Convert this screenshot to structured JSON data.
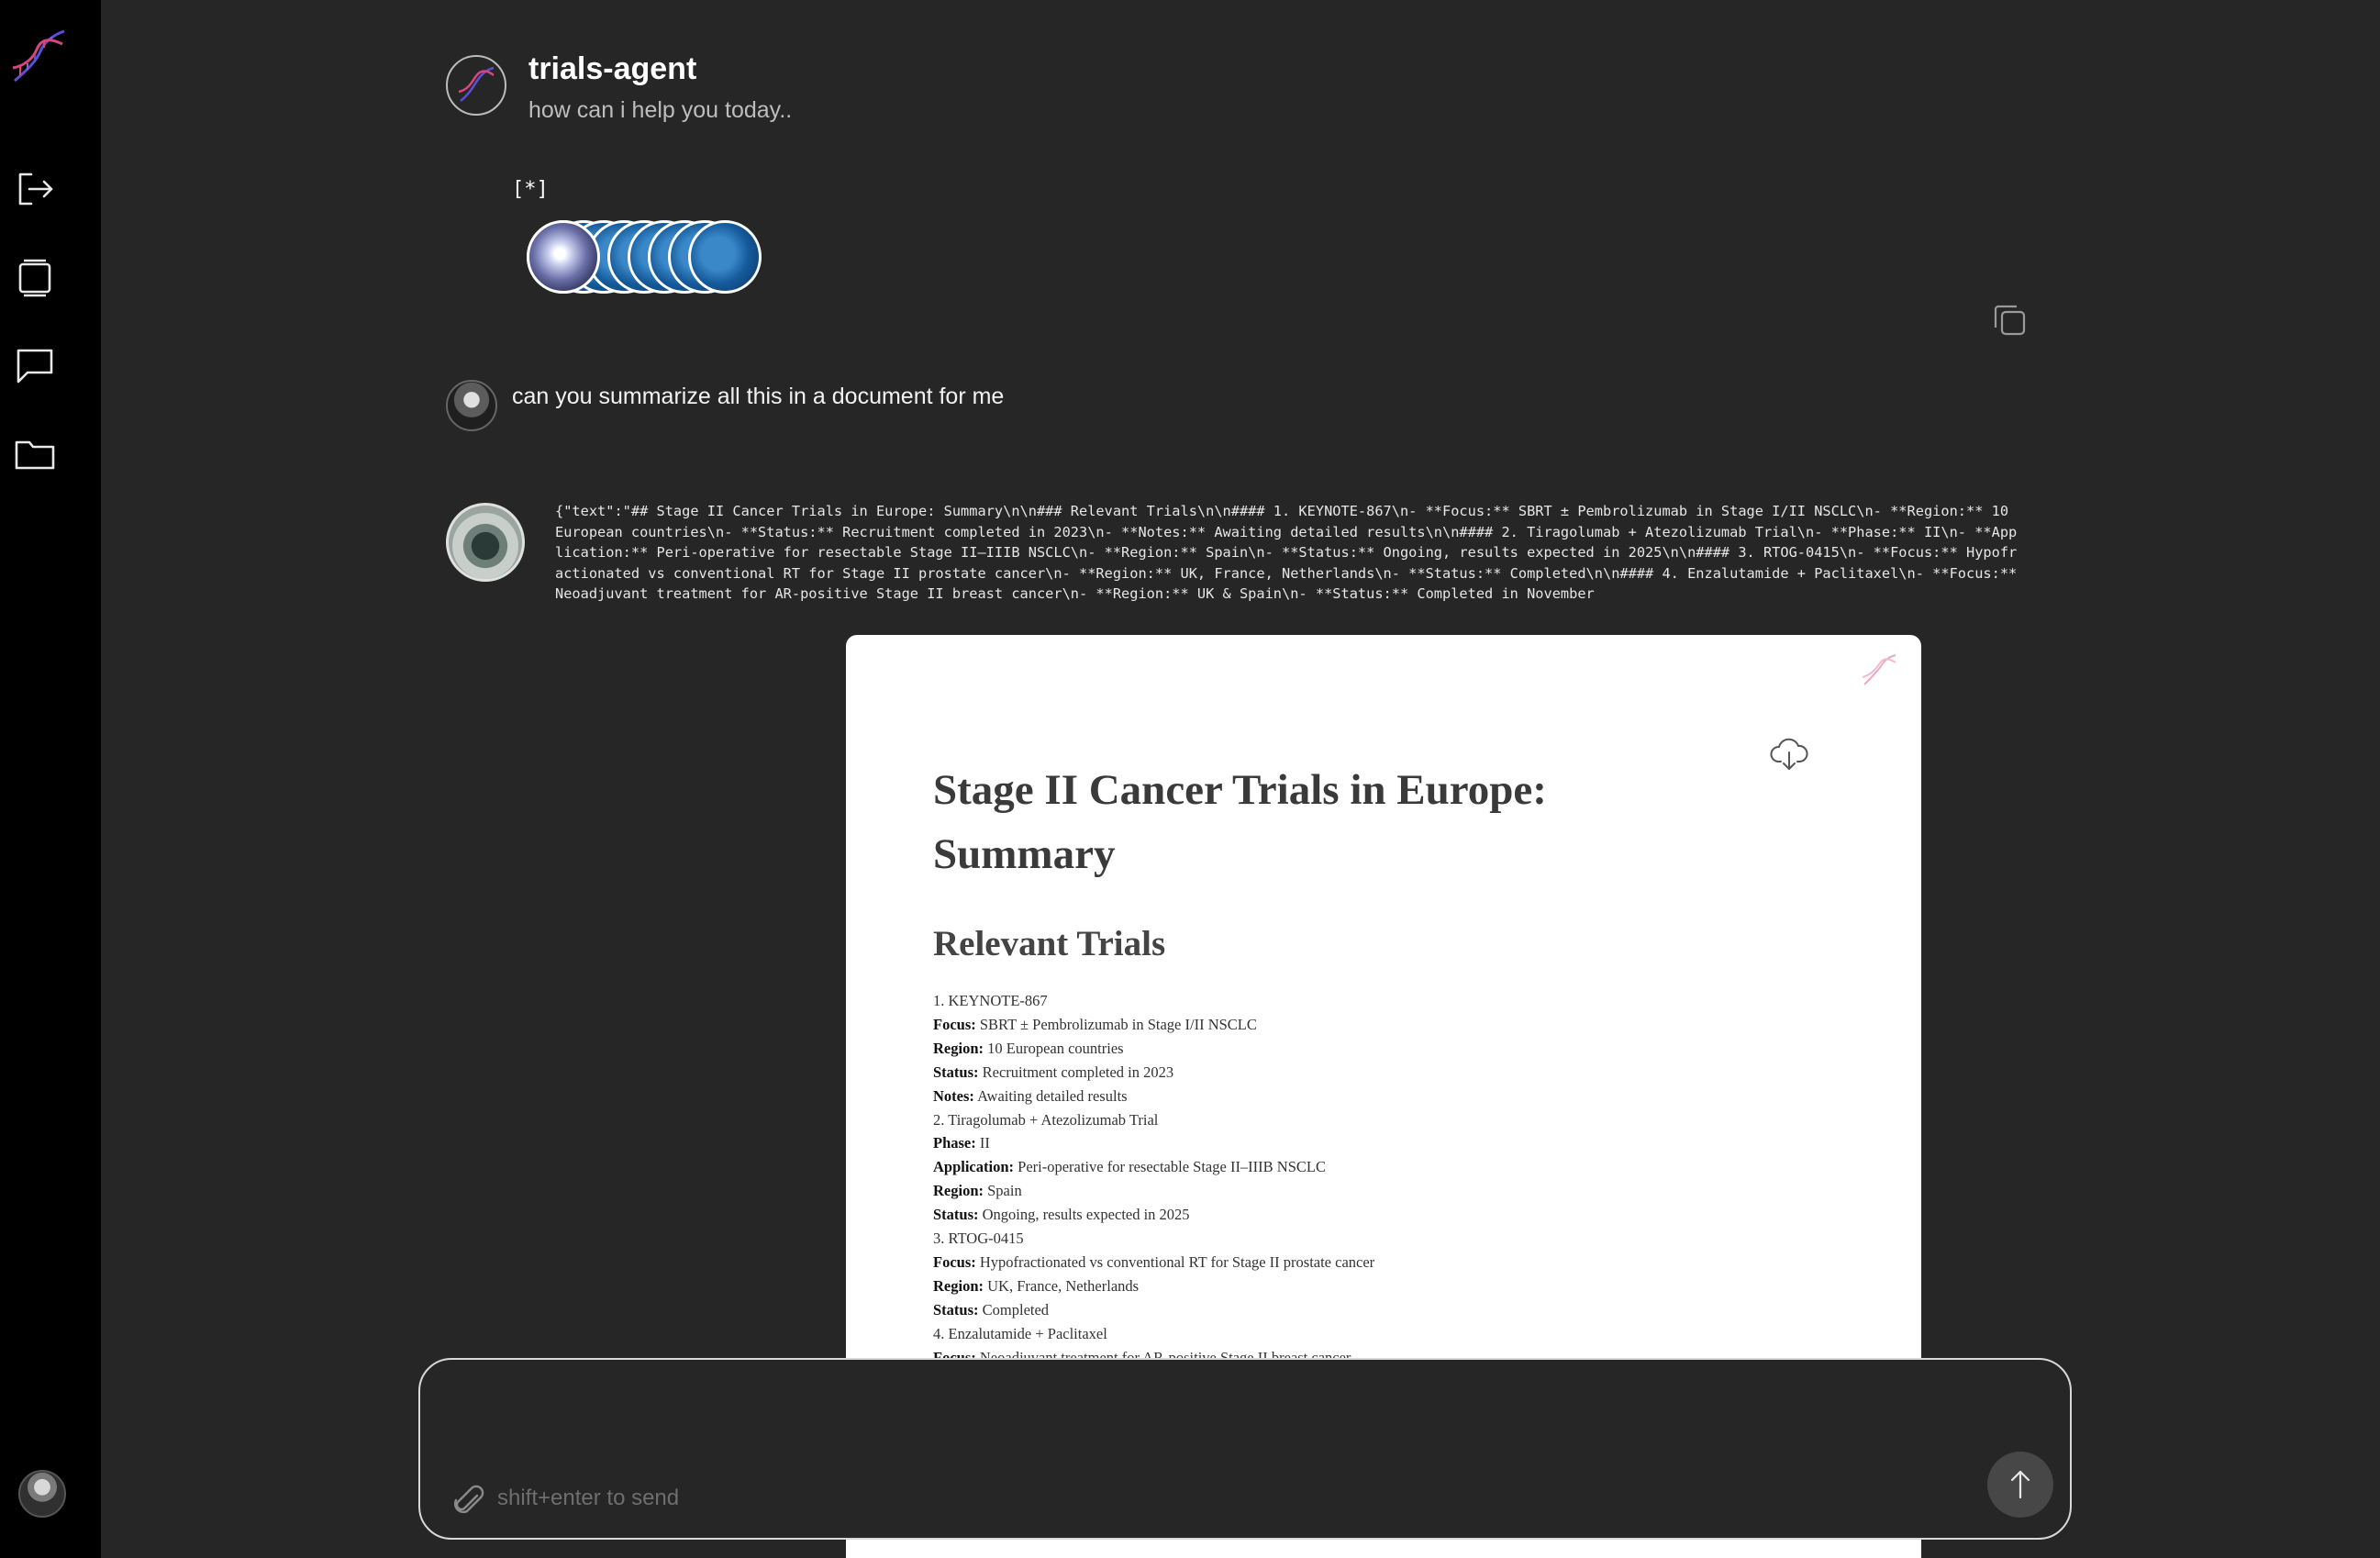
{
  "header": {
    "title": "trials-agent",
    "subtitle": "how can i help you today.."
  },
  "stream": {
    "badge": "[*]"
  },
  "messages": {
    "user": "can you summarize all this in a document for me",
    "agent_raw": "{\"text\":\"## Stage II Cancer Trials in Europe: Summary\\n\\n### Relevant Trials\\n\\n#### 1. KEYNOTE-867\\n- **Focus:** SBRT ± Pembrolizumab in Stage I/II NSCLC\\n- **Region:** 10 European countries\\n- **Status:** Recruitment completed in 2023\\n- **Notes:** Awaiting detailed results\\n\\n#### 2. Tiragolumab + Atezolizumab Trial\\n- **Phase:** II\\n- **Application:** Peri-operative for resectable Stage II–IIIB NSCLC\\n- **Region:** Spain\\n- **Status:** Ongoing, results expected in 2025\\n\\n#### 3. RTOG-0415\\n- **Focus:** Hypofractionated vs conventional RT for Stage II prostate cancer\\n- **Region:** UK, France, Netherlands\\n- **Status:** Completed\\n\\n#### 4. Enzalutamide + Paclitaxel\\n- **Focus:** Neoadjuvant treatment for AR-positive Stage II breast cancer\\n- **Region:** UK & Spain\\n- **Status:** Completed in November"
  },
  "document": {
    "title": "Stage II Cancer Trials in Europe: Summary",
    "section": "Relevant Trials",
    "trials": [
      {
        "heading": "1. KEYNOTE-867",
        "fields": [
          {
            "label": "Focus:",
            "value": "SBRT ± Pembrolizumab in Stage I/II NSCLC"
          },
          {
            "label": "Region:",
            "value": "10 European countries"
          },
          {
            "label": "Status:",
            "value": "Recruitment completed in 2023"
          },
          {
            "label": "Notes:",
            "value": "Awaiting detailed results"
          }
        ]
      },
      {
        "heading": "2. Tiragolumab + Atezolizumab Trial",
        "fields": [
          {
            "label": "Phase:",
            "value": "II"
          },
          {
            "label": "Application:",
            "value": "Peri-operative for resectable Stage II–IIIB NSCLC"
          },
          {
            "label": "Region:",
            "value": "Spain"
          },
          {
            "label": "Status:",
            "value": "Ongoing, results expected in 2025"
          }
        ]
      },
      {
        "heading": "3. RTOG-0415",
        "fields": [
          {
            "label": "Focus:",
            "value": "Hypofractionated vs conventional RT for Stage II prostate cancer"
          },
          {
            "label": "Region:",
            "value": "UK, France, Netherlands"
          },
          {
            "label": "Status:",
            "value": "Completed"
          }
        ]
      },
      {
        "heading": "4. Enzalutamide + Paclitaxel",
        "fields": [
          {
            "label": "Focus:",
            "value": "Neoadjuvant treatment for AR-positive Stage II breast cancer"
          }
        ]
      }
    ]
  },
  "composer": {
    "placeholder": "shift+enter to send"
  },
  "icons": {
    "logo": "dna-logo-icon",
    "sidebar": [
      "logout-icon",
      "layers-icon",
      "chat-icon",
      "folder-icon"
    ],
    "copy": "copy-icon",
    "download": "cloud-download-icon",
    "attach": "paperclip-icon",
    "send": "arrow-up-icon"
  },
  "colors": {
    "background": "#262627",
    "sidebar": "#000000",
    "document": "#ffffff",
    "dna_pink": "#d9467a",
    "dna_blue": "#5a4fd6",
    "bubble_blue": "#155a9a"
  }
}
